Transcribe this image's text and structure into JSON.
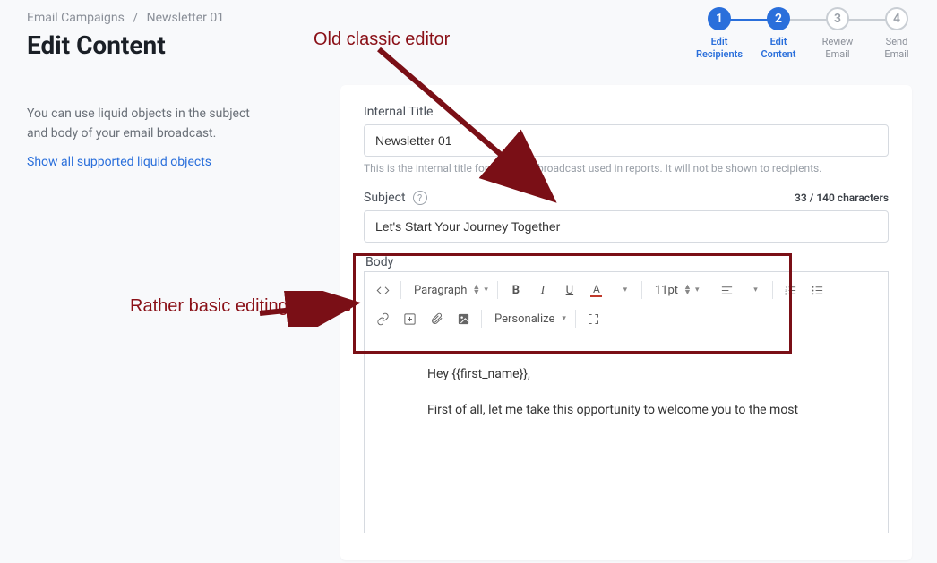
{
  "breadcrumb": {
    "parent": "Email Campaigns",
    "sep": "/",
    "current": "Newsletter 01"
  },
  "page_title": "Edit Content",
  "hint": "You can use liquid objects in the subject and body of your email broadcast.",
  "liquid_link": "Show all supported liquid objects",
  "stepper": [
    {
      "num": "1",
      "label": "Edit\nRecipients",
      "active": true
    },
    {
      "num": "2",
      "label": "Edit\nContent",
      "active": true
    },
    {
      "num": "3",
      "label": "Review\nEmail",
      "active": false
    },
    {
      "num": "4",
      "label": "Send\nEmail",
      "active": false
    }
  ],
  "form": {
    "internal_title_label": "Internal Title",
    "internal_title_value": "Newsletter 01",
    "internal_title_help": "This is the internal title for the email broadcast used in reports. It will not be shown to recipients.",
    "subject_label": "Subject",
    "subject_value": "Let's Start Your Journey Together",
    "char_count": "33 / 140 characters",
    "body_label": "Body"
  },
  "toolbar": {
    "paragraph": "Paragraph",
    "font_size": "11pt",
    "personalize": "Personalize"
  },
  "editor": {
    "line1": "Hey {{first_name}},",
    "line2": "First of all, let me take this opportunity to welcome you to the most"
  },
  "annotations": {
    "top": "Old classic editor",
    "left": "Rather basic editing options"
  }
}
